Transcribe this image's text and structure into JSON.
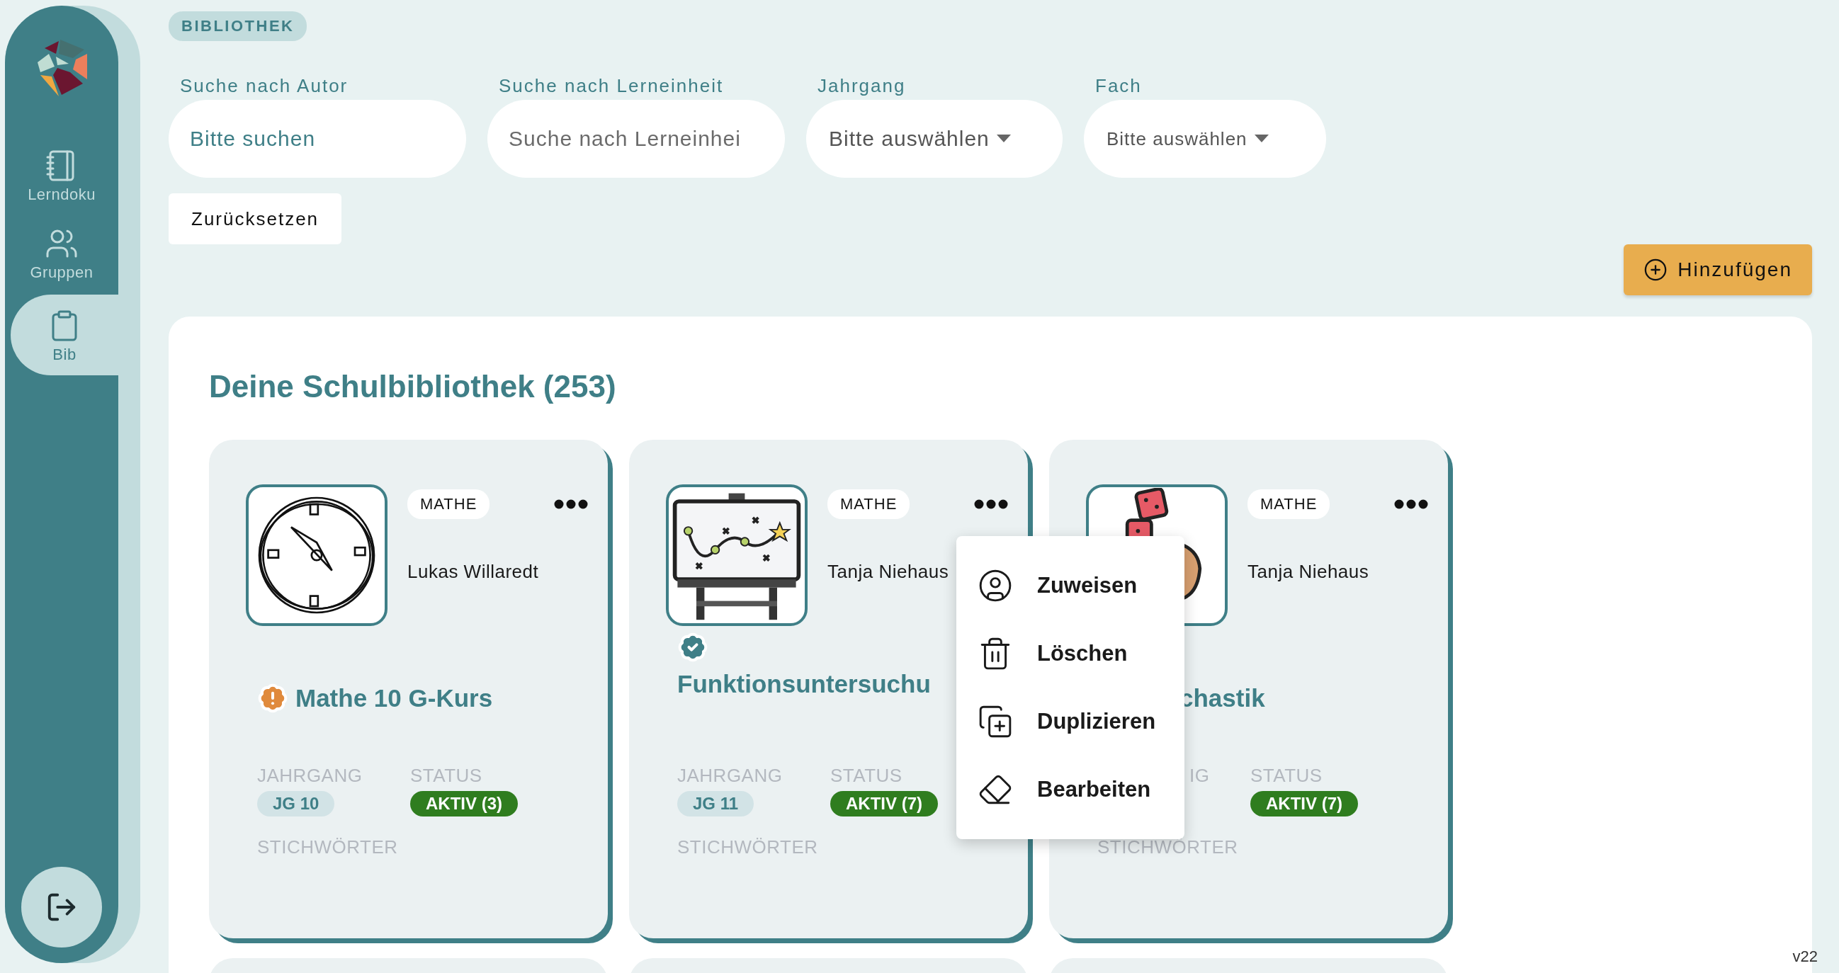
{
  "sidebar": {
    "items": [
      {
        "label": "Lerndoku",
        "selected": false
      },
      {
        "label": "Gruppen",
        "selected": false
      },
      {
        "label": "Bib",
        "selected": true
      }
    ]
  },
  "breadcrumb": "BIBLIOTHEK",
  "filters": [
    {
      "kind": "search",
      "label": "Suche nach Autor",
      "placeholder": "Bitte suchen",
      "focused": true
    },
    {
      "kind": "search",
      "label": "Suche nach Lerneinheit",
      "placeholder": "Suche nach Lerneinhei",
      "focused": false
    },
    {
      "kind": "select",
      "label": "Jahrgang",
      "value": "Bitte auswählen"
    },
    {
      "kind": "select",
      "label": "Fach",
      "value": "Bitte auswählen"
    }
  ],
  "reset_button": "Zurücksetzen",
  "add_button": "Hinzufügen",
  "library": {
    "title": "Deine Schulbibliothek (253)",
    "cards": [
      {
        "subject": "MATHE",
        "author": "Lukas Willaredt",
        "title": "Mathe 10 G-Kurs",
        "warning": true,
        "verified": false,
        "jahrgang_label": "JAHRGANG",
        "jahrgang": "JG 10",
        "status_label": "STATUS",
        "status": "AKTIV (3)",
        "keywords_label": "STICHWÖRTER",
        "menu_open": false
      },
      {
        "subject": "MATHE",
        "author": "Tanja Niehaus",
        "title": "Funktionsuntersuchu",
        "warning": false,
        "verified": true,
        "jahrgang_label": "JAHRGANG",
        "jahrgang": "JG 11",
        "status_label": "STATUS",
        "status": "AKTIV (7)",
        "keywords_label": "STICHWÖRTER",
        "menu_open": true
      },
      {
        "subject": "MATHE",
        "author": "Tanja Niehaus",
        "title": "chastik",
        "warning": false,
        "verified": false,
        "jahrgang_label": "IG",
        "status_label": "STATUS",
        "status": "AKTIV (7)",
        "keywords_label": "STICHWÖRTER",
        "menu_open": false
      }
    ]
  },
  "context_menu": [
    "Zuweisen",
    "Löschen",
    "Duplizieren",
    "Bearbeiten"
  ],
  "version": "v22"
}
